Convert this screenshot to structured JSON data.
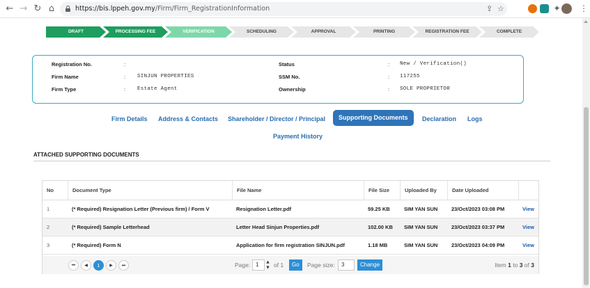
{
  "browser": {
    "url_host": "https://bis.lppeh.gov.my",
    "url_path": "/Firm/Firm_RegistrationInformation",
    "icons": [
      "back-arrow-icon",
      "forward-arrow-icon",
      "reload-icon",
      "home-icon",
      "lock-icon",
      "share-icon",
      "star-icon",
      "puzzle-icon",
      "sidebar-icon",
      "menu-icon"
    ]
  },
  "steps": [
    {
      "label": "DRAFT",
      "state": "done"
    },
    {
      "label": "PROCESSING FEE",
      "state": "done"
    },
    {
      "label": "VERIFICATION",
      "state": "current"
    },
    {
      "label": "SCHEDULING",
      "state": "todo"
    },
    {
      "label": "APPROVAL",
      "state": "todo"
    },
    {
      "label": "PRINTING",
      "state": "todo"
    },
    {
      "label": "REGISTRATION FEE",
      "state": "todo"
    },
    {
      "label": "COMPLETE",
      "state": "todo"
    }
  ],
  "info": {
    "colon": ":",
    "registration_no_label": "Registration No.",
    "registration_no_value": "",
    "firm_name_label": "Firm Name",
    "firm_name_value": "SINJUN PROPERTIES",
    "firm_type_label": "Firm Type",
    "firm_type_value": "Estate Agent",
    "status_label": "Status",
    "status_value": "New / Verification()",
    "ssm_label": "SSM No.",
    "ssm_value": "117255",
    "ownership_label": "Ownership",
    "ownership_value": "SOLE PROPRIETOR"
  },
  "tabs": {
    "firm_details": "Firm Details",
    "address_contacts": "Address & Contacts",
    "shareholder": "Shareholder / Director / Principal",
    "supporting_documents": "Supporting Documents",
    "declaration": "Declaration",
    "logs": "Logs",
    "payment_history": "Payment History",
    "active": "supporting_documents"
  },
  "section": {
    "title": "ATTACHED SUPPORTING DOCUMENTS"
  },
  "table": {
    "headers": [
      "No",
      "Document Type",
      "File Name",
      "File Size",
      "Uploaded By",
      "Date Uploaded",
      ""
    ],
    "rows": [
      [
        "1",
        "(* Required) Resignation Letter (Previous firm) / Form V",
        "Resignation Letter.pdf",
        "59.25 KB",
        "SIM YAN SUN",
        "23/Oct/2023 03:08 PM",
        "View"
      ],
      [
        "2",
        "(* Required) Sample Letterhead",
        "Letter Head Sinjun Properties.pdf",
        "102.00 KB",
        "SIM YAN SUN",
        "23/Oct/2023 03:37 PM",
        "View"
      ],
      [
        "3",
        "(* Required) Form N",
        "Application for firm registration SINJUN.pdf",
        "1.18 MB",
        "SIM YAN SUN",
        "23/Oct/2023 04:09 PM",
        "View"
      ]
    ]
  },
  "pager": {
    "current_page": "1",
    "page_label": "Page:",
    "page_input": "1",
    "of_label": "of 1",
    "go_label": "Go",
    "page_size_label": "Page size:",
    "page_size_value": "3",
    "change_label": "Change",
    "item_prefix": "Item",
    "item_from": "1",
    "item_to_label": "to",
    "item_to": "3",
    "item_of_label": "of",
    "item_total": "3"
  }
}
